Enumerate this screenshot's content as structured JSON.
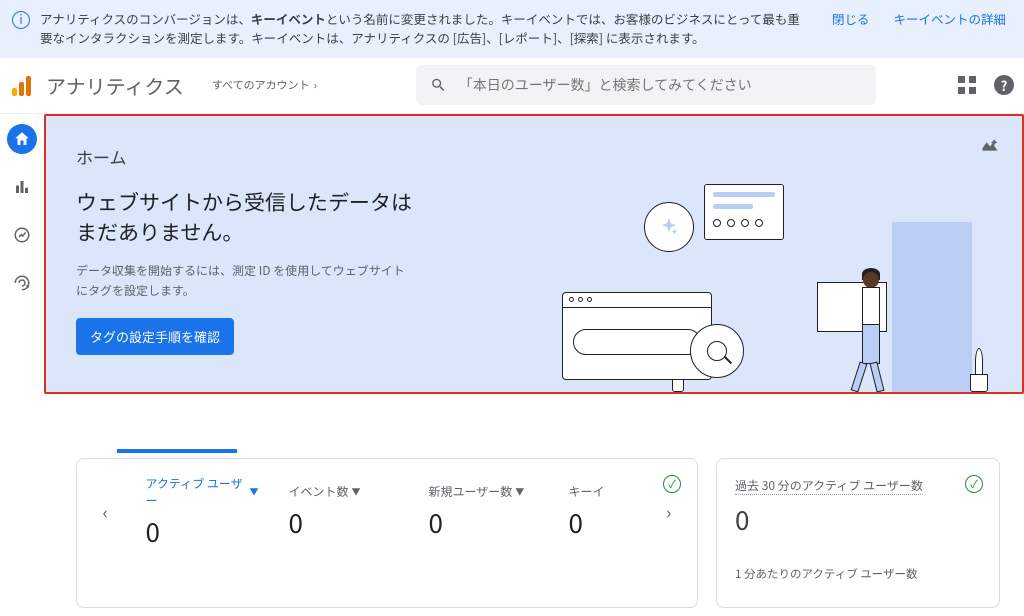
{
  "notice": {
    "text_pre": "アナリティクスのコンバージョンは、",
    "text_bold": "キーイベント",
    "text_post": "という名前に変更されました。キーイベントでは、お客様のビジネスにとって最も重要なインタラクションを測定します。キーイベントは、アナリティクスの [広告]、[レポート]、[探索] に表示されます。",
    "close": "閉じる",
    "details": "キーイベントの詳細"
  },
  "header": {
    "brand": "アナリティクス",
    "account_label": "すべてのアカウント",
    "search_placeholder": "「本日のユーザー数」と検索してみてください"
  },
  "hero": {
    "title": "ホーム",
    "heading_line1": "ウェブサイトから受信したデータは",
    "heading_line2": "まだありません。",
    "desc": "データ収集を開始するには、測定 ID を使用してウェブサイトにタグを設定します。",
    "button": "タグの設定手順を確認"
  },
  "metrics": {
    "items": [
      {
        "label": "アクティブ ユーザー",
        "value": "0",
        "active": true
      },
      {
        "label": "イベント数",
        "value": "0",
        "active": false
      },
      {
        "label": "新規ユーザー数",
        "value": "0",
        "active": false
      },
      {
        "label": "キーイ",
        "value": "0",
        "active": false
      }
    ]
  },
  "realtime": {
    "title": "過去 30 分のアクティブ ユーザー数",
    "value": "0",
    "subtitle": "1 分あたりのアクティブ ユーザー数"
  }
}
